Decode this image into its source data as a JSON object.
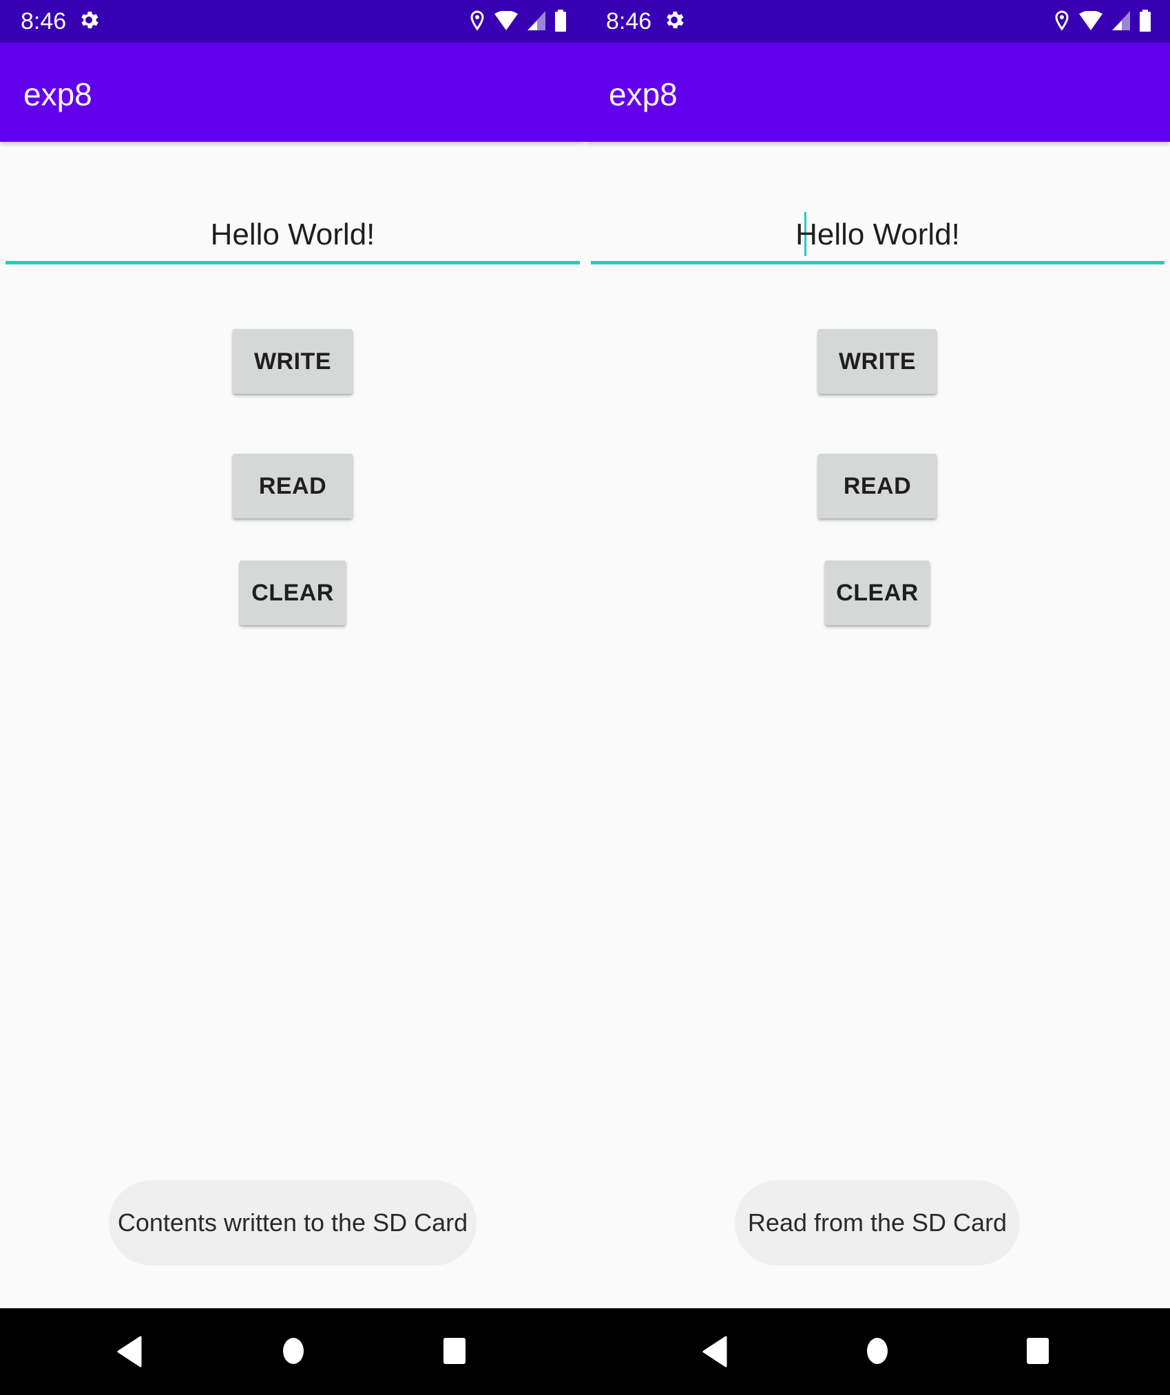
{
  "screens": [
    {
      "status": {
        "time": "8:46"
      },
      "app_bar": {
        "title": "exp8"
      },
      "text_field": {
        "value": "Hello World!"
      },
      "buttons": {
        "write": "WRITE",
        "read": "READ",
        "clear": "CLEAR"
      },
      "toast": {
        "message": "Contents written to the SD Card"
      }
    },
    {
      "status": {
        "time": "8:46"
      },
      "app_bar": {
        "title": "exp8"
      },
      "text_field": {
        "value": "Hello World!"
      },
      "buttons": {
        "write": "WRITE",
        "read": "READ",
        "clear": "CLEAR"
      },
      "toast": {
        "message": "Read from the SD Card"
      }
    }
  ],
  "icons": {
    "status_bar": [
      "gear-icon",
      "location-icon",
      "wifi-icon",
      "cell-signal-icon",
      "battery-icon"
    ],
    "nav_bar": [
      "back-icon",
      "home-icon",
      "recents-icon"
    ]
  },
  "colors": {
    "status_bar": "#3700b3",
    "app_bar": "#6200ee",
    "accent": "#1ad0c0",
    "button": "#d6d7d7",
    "toast": "#efefef",
    "background": "#fafafa",
    "nav_bar": "#000000"
  }
}
